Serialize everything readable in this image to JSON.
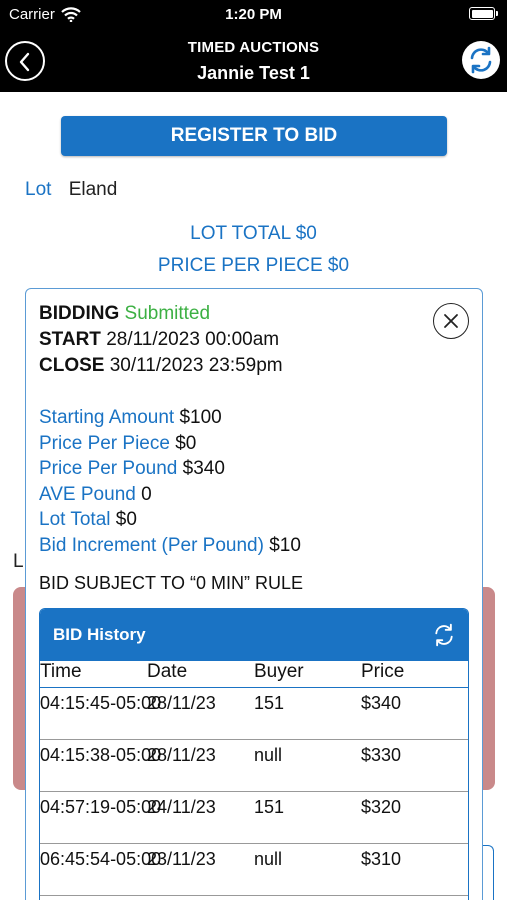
{
  "status_bar": {
    "carrier": "Carrier",
    "time": "1:20 PM"
  },
  "nav": {
    "title": "TIMED AUCTIONS",
    "subtitle": "Jannie Test 1",
    "back_icon": "chevron-left-icon",
    "refresh_icon": "refresh-icon"
  },
  "register_button": "REGISTER TO BID",
  "lot": {
    "label": "Lot",
    "value": "Eland"
  },
  "summary": {
    "lot_total_label": "LOT TOTAL",
    "lot_total_value": "$0",
    "ppp_label": "PRICE PER PIECE",
    "ppp_value": "$0"
  },
  "background": {
    "partial_letter": "L"
  },
  "card": {
    "bidding_label": "BIDDING",
    "bidding_status": "Submitted",
    "start_label": "START",
    "start_value": "28/11/2023 00:00am",
    "close_label": "CLOSE",
    "close_value": "30/11/2023 23:59pm",
    "details": [
      {
        "label": "Starting Amount",
        "value": "$100"
      },
      {
        "label": "Price Per Piece",
        "value": "$0"
      },
      {
        "label": "Price Per Pound",
        "value": "$340"
      },
      {
        "label": "AVE Pound",
        "value": "0"
      },
      {
        "label": "Lot Total",
        "value": "$0"
      },
      {
        "label": "Bid Increment (Per Pound)",
        "value": "$10"
      }
    ],
    "rule_text": "BID SUBJECT TO “0 MIN” RULE",
    "history": {
      "title": "BID History",
      "columns": [
        "Time",
        "Date",
        "Buyer",
        "Price"
      ],
      "rows": [
        {
          "time": "04:15:45-05:00",
          "date": "28/11/23",
          "buyer": "151",
          "price": "$340"
        },
        {
          "time": "04:15:38-05:00",
          "date": "28/11/23",
          "buyer": "null",
          "price": "$330"
        },
        {
          "time": "04:57:19-05:00",
          "date": "24/11/23",
          "buyer": "151",
          "price": "$320"
        },
        {
          "time": "06:45:54-05:00",
          "date": "23/11/23",
          "buyer": "null",
          "price": "$310"
        }
      ]
    }
  },
  "colors": {
    "accent": "#1a73c4",
    "status_green": "#3cb043",
    "panel_red": "#c9898a"
  }
}
